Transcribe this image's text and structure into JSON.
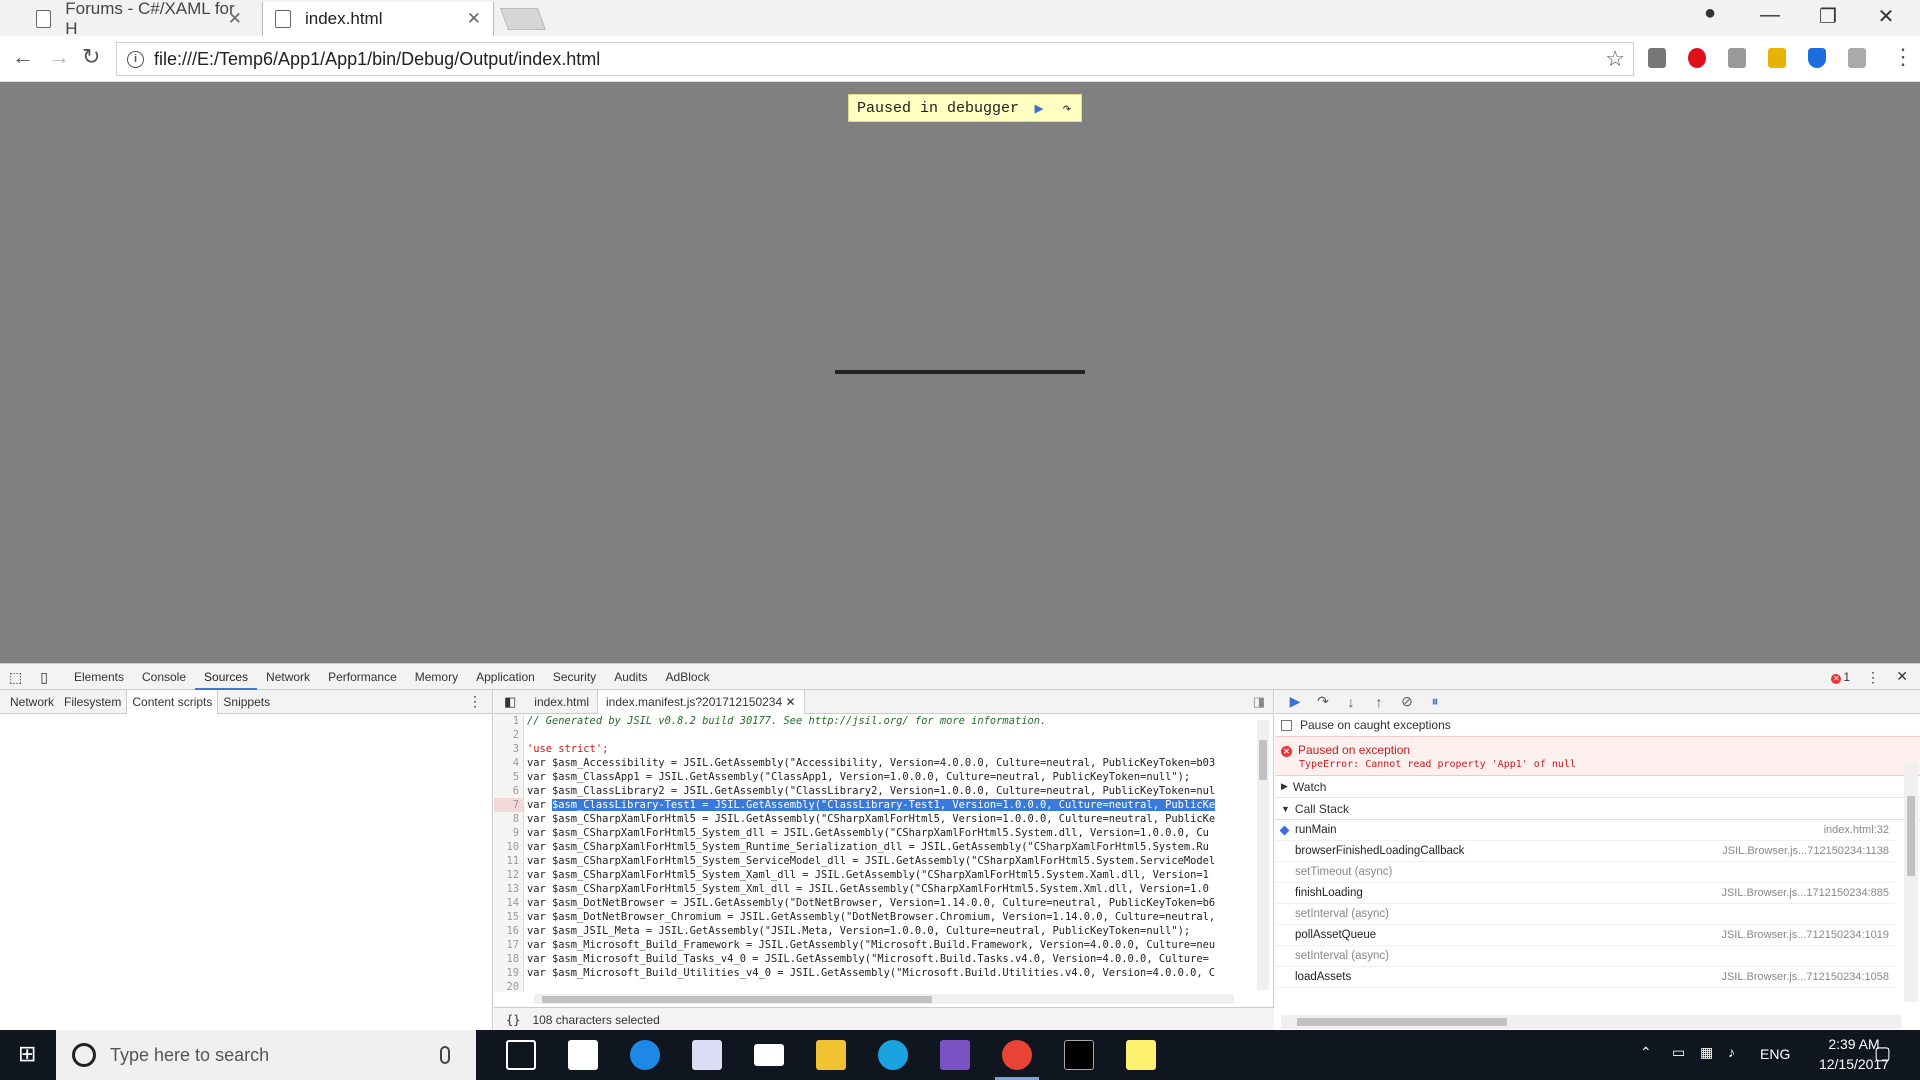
{
  "browser": {
    "tabs": [
      {
        "title": "Forums - C#/XAML for H",
        "active": false
      },
      {
        "title": "index.html",
        "active": true
      }
    ],
    "url": "file:///E:/Temp6/App1/App1/bin/Debug/Output/index.html"
  },
  "page": {
    "paused_label": "Paused in debugger"
  },
  "devtools": {
    "main_tabs": [
      "Elements",
      "Console",
      "Sources",
      "Network",
      "Performance",
      "Memory",
      "Application",
      "Security",
      "Audits",
      "AdBlock"
    ],
    "active_tab": "Sources",
    "error_count": "1",
    "navigator_tabs": [
      "Network",
      "Filesystem",
      "Content scripts",
      "Snippets"
    ],
    "active_navigator_tab": "Content scripts",
    "editor_tabs": [
      "index.html",
      "index.manifest.js?201712150234"
    ],
    "active_editor_tab": "index.manifest.js?201712150234",
    "code_lines": [
      {
        "n": "1",
        "text": "// Generated by JSIL v0.8.2 build 30177. See http://jsil.org/ for more information."
      },
      {
        "n": "2",
        "text": ""
      },
      {
        "n": "3",
        "text": "'use strict';"
      },
      {
        "n": "4",
        "text": "var $asm_Accessibility = JSIL.GetAssembly(\"Accessibility, Version=4.0.0.0, Culture=neutral, PublicKeyToken=b03"
      },
      {
        "n": "5",
        "text": "var $asm_ClassApp1 = JSIL.GetAssembly(\"ClassApp1, Version=1.0.0.0, Culture=neutral, PublicKeyToken=null\");"
      },
      {
        "n": "6",
        "text": "var $asm_ClassLibrary2 = JSIL.GetAssembly(\"ClassLibrary2, Version=1.0.0.0, Culture=neutral, PublicKeyToken=nul"
      },
      {
        "n": "7",
        "text": "var $asm_ClassLibrary-Test1 = JSIL.GetAssembly(\"ClassLibrary-Test1, Version=1.0.0.0, Culture=neutral, PublicKe"
      },
      {
        "n": "8",
        "text": "var $asm_CSharpXamlForHtml5 = JSIL.GetAssembly(\"CSharpXamlForHtml5, Version=1.0.0.0, Culture=neutral, PublicKe"
      },
      {
        "n": "9",
        "text": "var $asm_CSharpXamlForHtml5_System_dll = JSIL.GetAssembly(\"CSharpXamlForHtml5.System.dll, Version=1.0.0.0, Cu"
      },
      {
        "n": "10",
        "text": "var $asm_CSharpXamlForHtml5_System_Runtime_Serialization_dll = JSIL.GetAssembly(\"CSharpXamlForHtml5.System.Ru"
      },
      {
        "n": "11",
        "text": "var $asm_CSharpXamlForHtml5_System_ServiceModel_dll = JSIL.GetAssembly(\"CSharpXamlForHtml5.System.ServiceModel"
      },
      {
        "n": "12",
        "text": "var $asm_CSharpXamlForHtml5_System_Xaml_dll = JSIL.GetAssembly(\"CSharpXamlForHtml5.System.Xaml.dll, Version=1"
      },
      {
        "n": "13",
        "text": "var $asm_CSharpXamlForHtml5_System_Xml_dll = JSIL.GetAssembly(\"CSharpXamlForHtml5.System.Xml.dll, Version=1.0"
      },
      {
        "n": "14",
        "text": "var $asm_DotNetBrowser = JSIL.GetAssembly(\"DotNetBrowser, Version=1.14.0.0, Culture=neutral, PublicKeyToken=b6"
      },
      {
        "n": "15",
        "text": "var $asm_DotNetBrowser_Chromium = JSIL.GetAssembly(\"DotNetBrowser.Chromium, Version=1.14.0.0, Culture=neutral,"
      },
      {
        "n": "16",
        "text": "var $asm_JSIL_Meta = JSIL.GetAssembly(\"JSIL.Meta, Version=1.0.0.0, Culture=neutral, PublicKeyToken=null\");"
      },
      {
        "n": "17",
        "text": "var $asm_Microsoft_Build_Framework = JSIL.GetAssembly(\"Microsoft.Build.Framework, Version=4.0.0.0, Culture=neu"
      },
      {
        "n": "18",
        "text": "var $asm_Microsoft_Build_Tasks_v4_0 = JSIL.GetAssembly(\"Microsoft.Build.Tasks.v4.0, Version=4.0.0.0, Culture="
      },
      {
        "n": "19",
        "text": "var $asm_Microsoft_Build_Utilities_v4_0 = JSIL.GetAssembly(\"Microsoft.Build.Utilities.v4.0, Version=4.0.0.0, C"
      },
      {
        "n": "20",
        "text": ""
      }
    ],
    "selected_line": "7",
    "status_text": "108 characters selected",
    "pause_on_caught": "Pause on caught exceptions",
    "exception_title": "Paused on exception",
    "exception_message": "TypeError: Cannot read property 'App1' of null",
    "watch_label": "Watch",
    "callstack_label": "Call Stack",
    "call_stack": [
      {
        "name": "runMain",
        "location": "index.html:32",
        "async": false,
        "active": true
      },
      {
        "name": "browserFinishedLoadingCallback",
        "location": "JSIL.Browser.js...712150234:1138",
        "async": false,
        "active": false
      },
      {
        "name": "setTimeout (async)",
        "location": "",
        "async": true,
        "active": false
      },
      {
        "name": "finishLoading",
        "location": "JSIL.Browser.js...1712150234:885",
        "async": false,
        "active": false
      },
      {
        "name": "setInterval (async)",
        "location": "",
        "async": true,
        "active": false
      },
      {
        "name": "pollAssetQueue",
        "location": "JSIL.Browser.js...712150234:1019",
        "async": false,
        "active": false
      },
      {
        "name": "setInterval (async)",
        "location": "",
        "async": true,
        "active": false
      },
      {
        "name": "loadAssets",
        "location": "JSIL.Browser.js...712150234:1058",
        "async": false,
        "active": false
      }
    ]
  },
  "taskbar": {
    "search_placeholder": "Type here to search",
    "language": "ENG",
    "time": "2:39 AM",
    "date": "12/15/2017"
  }
}
